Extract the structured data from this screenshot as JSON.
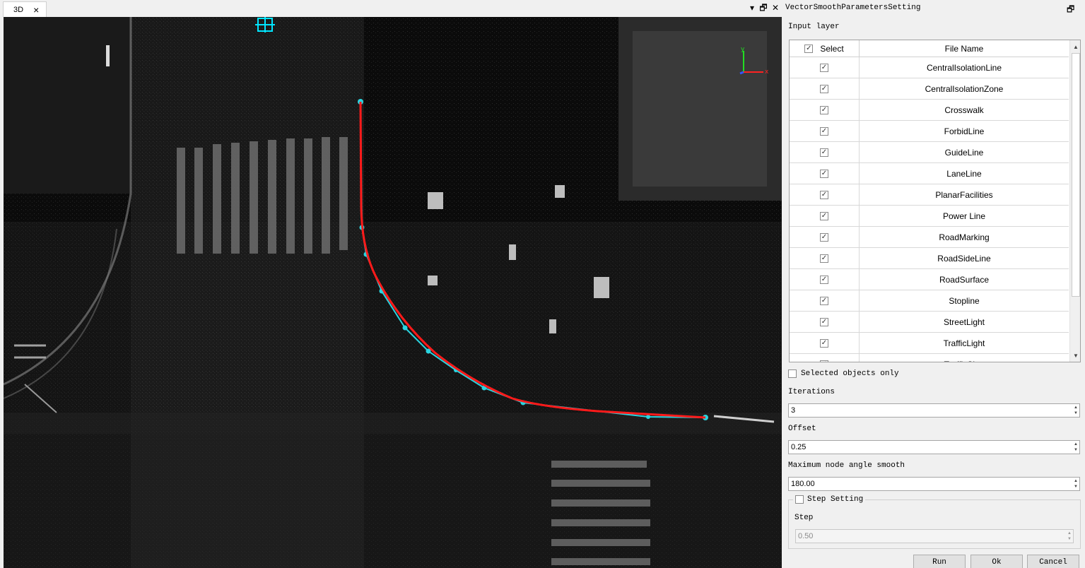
{
  "view": {
    "tab_label": "3D",
    "close_icon": "×",
    "pin_icon": "▾",
    "restore_icon": "🗗",
    "panel_close_icon": "✕"
  },
  "axis_gizmo": {
    "x": "x",
    "y": "y"
  },
  "panel": {
    "title": "VectorSmoothParametersSetting",
    "restore_icon": "🗗",
    "input_layer_label": "Input layer",
    "table": {
      "columns": [
        "Select",
        "File Name"
      ],
      "rows": [
        {
          "checked": true,
          "name": "CentralIsolationLine"
        },
        {
          "checked": true,
          "name": "CentralIsolationZone"
        },
        {
          "checked": true,
          "name": "Crosswalk"
        },
        {
          "checked": true,
          "name": "ForbidLine"
        },
        {
          "checked": true,
          "name": "GuideLine"
        },
        {
          "checked": true,
          "name": "LaneLine"
        },
        {
          "checked": true,
          "name": "PlanarFacilities"
        },
        {
          "checked": true,
          "name": "Power Line"
        },
        {
          "checked": true,
          "name": "RoadMarking"
        },
        {
          "checked": true,
          "name": "RoadSideLine"
        },
        {
          "checked": true,
          "name": "RoadSurface"
        },
        {
          "checked": true,
          "name": "Stopline"
        },
        {
          "checked": true,
          "name": "StreetLight"
        },
        {
          "checked": true,
          "name": "TrafficLight"
        },
        {
          "checked": true,
          "name": "TrafficSign"
        }
      ]
    },
    "selected_only_label": "Selected objects only",
    "iterations": {
      "label": "Iterations",
      "value": "3"
    },
    "offset": {
      "label": "Offset",
      "value": "0.25"
    },
    "max_angle": {
      "label": "Maximum node angle smooth",
      "value": "180.00"
    },
    "step_setting": {
      "label": "Step Setting",
      "checked": false,
      "step_label": "Step",
      "step_value": "0.50"
    },
    "buttons": {
      "run": "Run",
      "ok": "Ok",
      "cancel": "Cancel"
    }
  },
  "colors": {
    "original_line": "#2ad4e0",
    "smoothed_line": "#ff1a1a",
    "background": "#050505"
  }
}
